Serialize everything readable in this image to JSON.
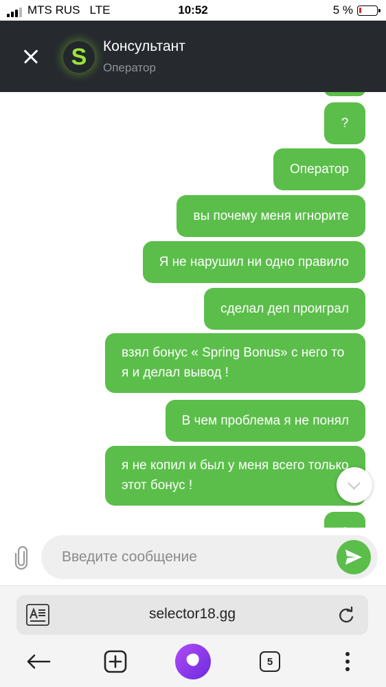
{
  "status_bar": {
    "carrier": "MTS RUS",
    "network": "LTE",
    "time": "10:52",
    "battery_percent": "5 %",
    "signal_bars_filled": 3,
    "signal_bars_total": 4,
    "battery_level": 0.05,
    "battery_color": "#e02020"
  },
  "chat_header": {
    "avatar_letter": "S",
    "title": "Консультант",
    "subtitle": "Оператор",
    "close_icon": "close-icon",
    "background": "#262a2f",
    "avatar_color": "#9be43a"
  },
  "messages": [
    {
      "text": "?",
      "sender": "user"
    },
    {
      "text": "Оператор",
      "sender": "user"
    },
    {
      "text": "вы почему меня игнорите",
      "sender": "user"
    },
    {
      "text": "Я не нарушил ни одно правило",
      "sender": "user"
    },
    {
      "text": "сделал деп проиграл",
      "sender": "user"
    },
    {
      "text": "взял бонус « Spring Bonus» с него то я и делал вывод !",
      "sender": "user"
    },
    {
      "text": "В чем проблема я не понял",
      "sender": "user"
    },
    {
      "text": "я не копил и был у меня всего только этот бонус !",
      "sender": "user"
    },
    {
      "text": "?",
      "sender": "user"
    }
  ],
  "bubble_color": "#5bbe4a",
  "composer": {
    "placeholder": "Введите сообщение",
    "value": "",
    "attach_icon": "paperclip-icon",
    "send_icon": "send-icon"
  },
  "browser": {
    "url": "selector18.gg",
    "reader_icon": "reader-mode-icon",
    "reload_icon": "reload-icon",
    "nav": {
      "back_icon": "back-arrow-icon",
      "new_tab_icon": "new-tab-icon",
      "assistant_icon": "alice-assistant-icon",
      "tabs_count": "5",
      "menu_icon": "more-vertical-icon"
    }
  }
}
